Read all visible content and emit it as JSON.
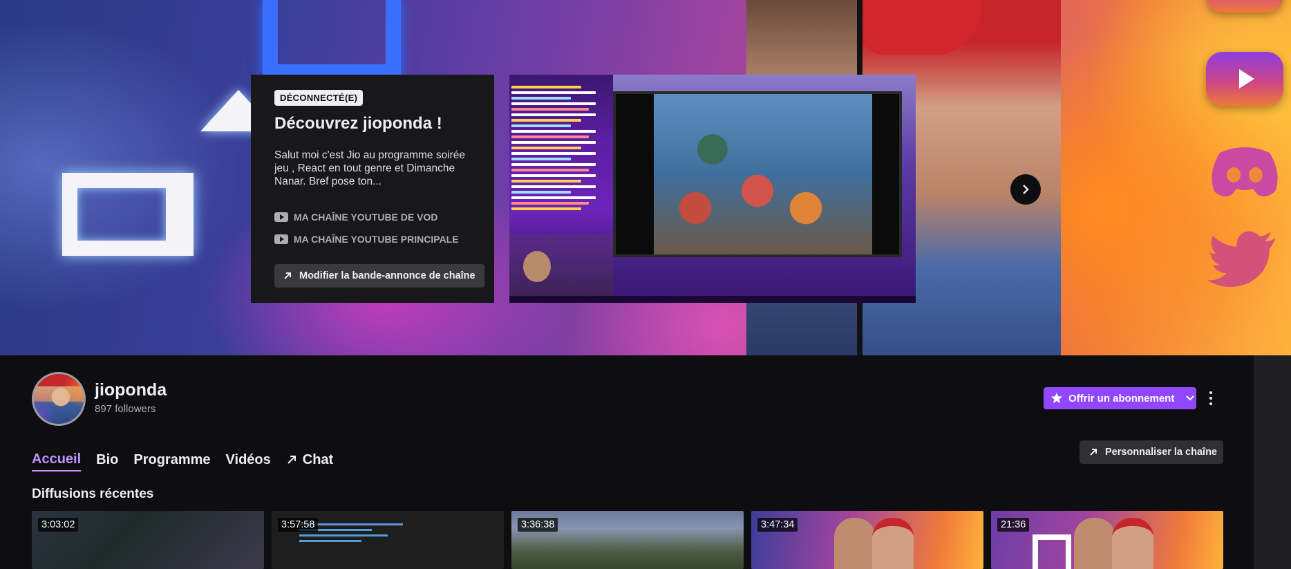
{
  "trailer": {
    "status_badge": "DÉCONNECTÉ(E)",
    "title": "Découvrez jioponda !",
    "description": "Salut moi c'est Jio au programme soirée jeu , React en tout genre et Dimanche Nanar. Bref pose ton...",
    "links": [
      {
        "label": "MA CHAÎNE YOUTUBE DE VOD",
        "icon": "youtube-icon"
      },
      {
        "label": "MA CHAÎNE YOUTUBE PRINCIPALE",
        "icon": "youtube-icon"
      }
    ],
    "edit_button": "Modifier la bande-annonce de chaîne"
  },
  "banner": {
    "social_icons": [
      "youtube-icon",
      "discord-icon",
      "twitter-icon"
    ]
  },
  "channel": {
    "name": "jioponda",
    "followers": "897 followers",
    "subscribe_button": "Offrir un abonnement",
    "customize_button": "Personnaliser la chaîne"
  },
  "tabs": [
    {
      "label": "Accueil",
      "active": true
    },
    {
      "label": "Bio",
      "active": false
    },
    {
      "label": "Programme",
      "active": false
    },
    {
      "label": "Vidéos",
      "active": false
    },
    {
      "label": "Chat",
      "active": false
    }
  ],
  "recent": {
    "title": "Diffusions récentes",
    "videos": [
      {
        "duration": "3:03:02"
      },
      {
        "duration": "3:57:58"
      },
      {
        "duration": "3:36:38"
      },
      {
        "duration": "3:47:34"
      },
      {
        "duration": "21:36"
      }
    ]
  },
  "colors": {
    "accent": "#9147ff",
    "accent_light": "#bf94ff",
    "background": "#0e0e10",
    "card": "#18181b"
  }
}
